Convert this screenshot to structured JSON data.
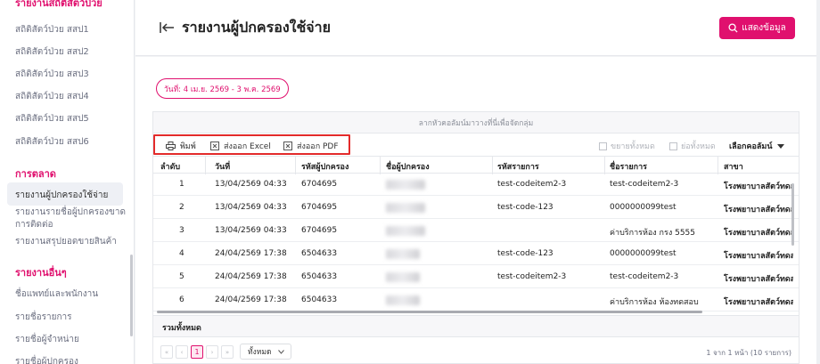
{
  "sidebar": {
    "top_title": "รายงานสถิติสัตว์ป่วย",
    "stats_items": [
      "สถิติสัตว์ป่วย สสป1",
      "สถิติสัตว์ป่วย สสป2",
      "สถิติสัตว์ป่วย สสป3",
      "สถิติสัตว์ป่วย สสป4",
      "สถิติสัตว์ป่วย สสป5",
      "สถิติสัตว์ป่วย สสป6"
    ],
    "marketing_title": "การตลาด",
    "marketing_items": [
      "รายงานผู้ปกครองใช้จ่าย",
      "รายงานรายชื่อผู้ปกครองขาด",
      "การติดต่อ",
      "รายงานสรุปยอดขายสินค้า"
    ],
    "other_title": "รายงานอื่นๆ",
    "other_items": [
      "ชื่อแพทย์และพนักงาน",
      "รายชื่อรายการ",
      "รายชื่อผู้จำหน่าย",
      "รายชื่อผู้ปกครอง"
    ]
  },
  "header": {
    "title": "รายงานผู้ปกครองใช้จ่าย",
    "show_button": "แสดงข้อมูล"
  },
  "filter": {
    "date_range": "วันที่: 4 เม.ย. 2569 - 3 พ.ค. 2569"
  },
  "grid": {
    "group_panel_hint": "ลากหัวคอลัมน์มาวางที่นี่เพื่อจัดกลุ่ม",
    "toolbar": {
      "print": "พิมพ์",
      "export_excel": "ส่งออก Excel",
      "export_pdf": "ส่งออก PDF",
      "expand_all": "ขยายทั้งหมด",
      "collapse_all": "ย่อทั้งหมด",
      "choose_columns": "เลือกคอลัมน์"
    },
    "columns": [
      "ลำดับ",
      "วันที่",
      "รหัสผู้ปกครอง",
      "ชื่อผู้ปกครอง",
      "รหัสรายการ",
      "ชื่อรายการ",
      "สาขา"
    ],
    "rows": [
      {
        "no": "1",
        "date": "13/04/2569 04:33",
        "owner_code": "6704695",
        "item_code": "test-codeitem2-3",
        "item_name": "test-codeitem2-3",
        "branch": "โรงพยาบาลสัตว์ทดสอ"
      },
      {
        "no": "2",
        "date": "13/04/2569 04:33",
        "owner_code": "6704695",
        "item_code": "test-code-123",
        "item_name": "0000000099test",
        "branch": "โรงพยาบาลสัตว์ทดสอ"
      },
      {
        "no": "3",
        "date": "13/04/2569 04:33",
        "owner_code": "6704695",
        "item_code": "",
        "item_name": "ค่าบริการห้อง กรง 5555",
        "branch": "โรงพยาบาลสัตว์ทดสอ"
      },
      {
        "no": "4",
        "date": "24/04/2569 17:38",
        "owner_code": "6504633",
        "item_code": "test-code-123",
        "item_name": "0000000099test",
        "branch": "โรงพยาบาลสัตว์ทดสอ"
      },
      {
        "no": "5",
        "date": "24/04/2569 17:38",
        "owner_code": "6504633",
        "item_code": "test-codeitem2-3",
        "item_name": "test-codeitem2-3",
        "branch": "โรงพยาบาลสัตว์ทดสอ"
      },
      {
        "no": "6",
        "date": "24/04/2569 17:38",
        "owner_code": "6504633",
        "item_code": "",
        "item_name": "ค่าบริการห้อง ห้องทดสอบ",
        "branch": "โรงพยาบาลสัตว์ทดสอ"
      }
    ],
    "total_label": "รวมทั้งหมด",
    "pager": {
      "first": "«",
      "prev": "‹",
      "current_page": "1",
      "next": "›",
      "last": "»",
      "page_size": "ทั้งหมด",
      "info": "1 จาก 1 หน้า (10 รายการ)"
    }
  },
  "colors": {
    "accent": "#e0106e",
    "highlight_box": "#e32b2b"
  }
}
